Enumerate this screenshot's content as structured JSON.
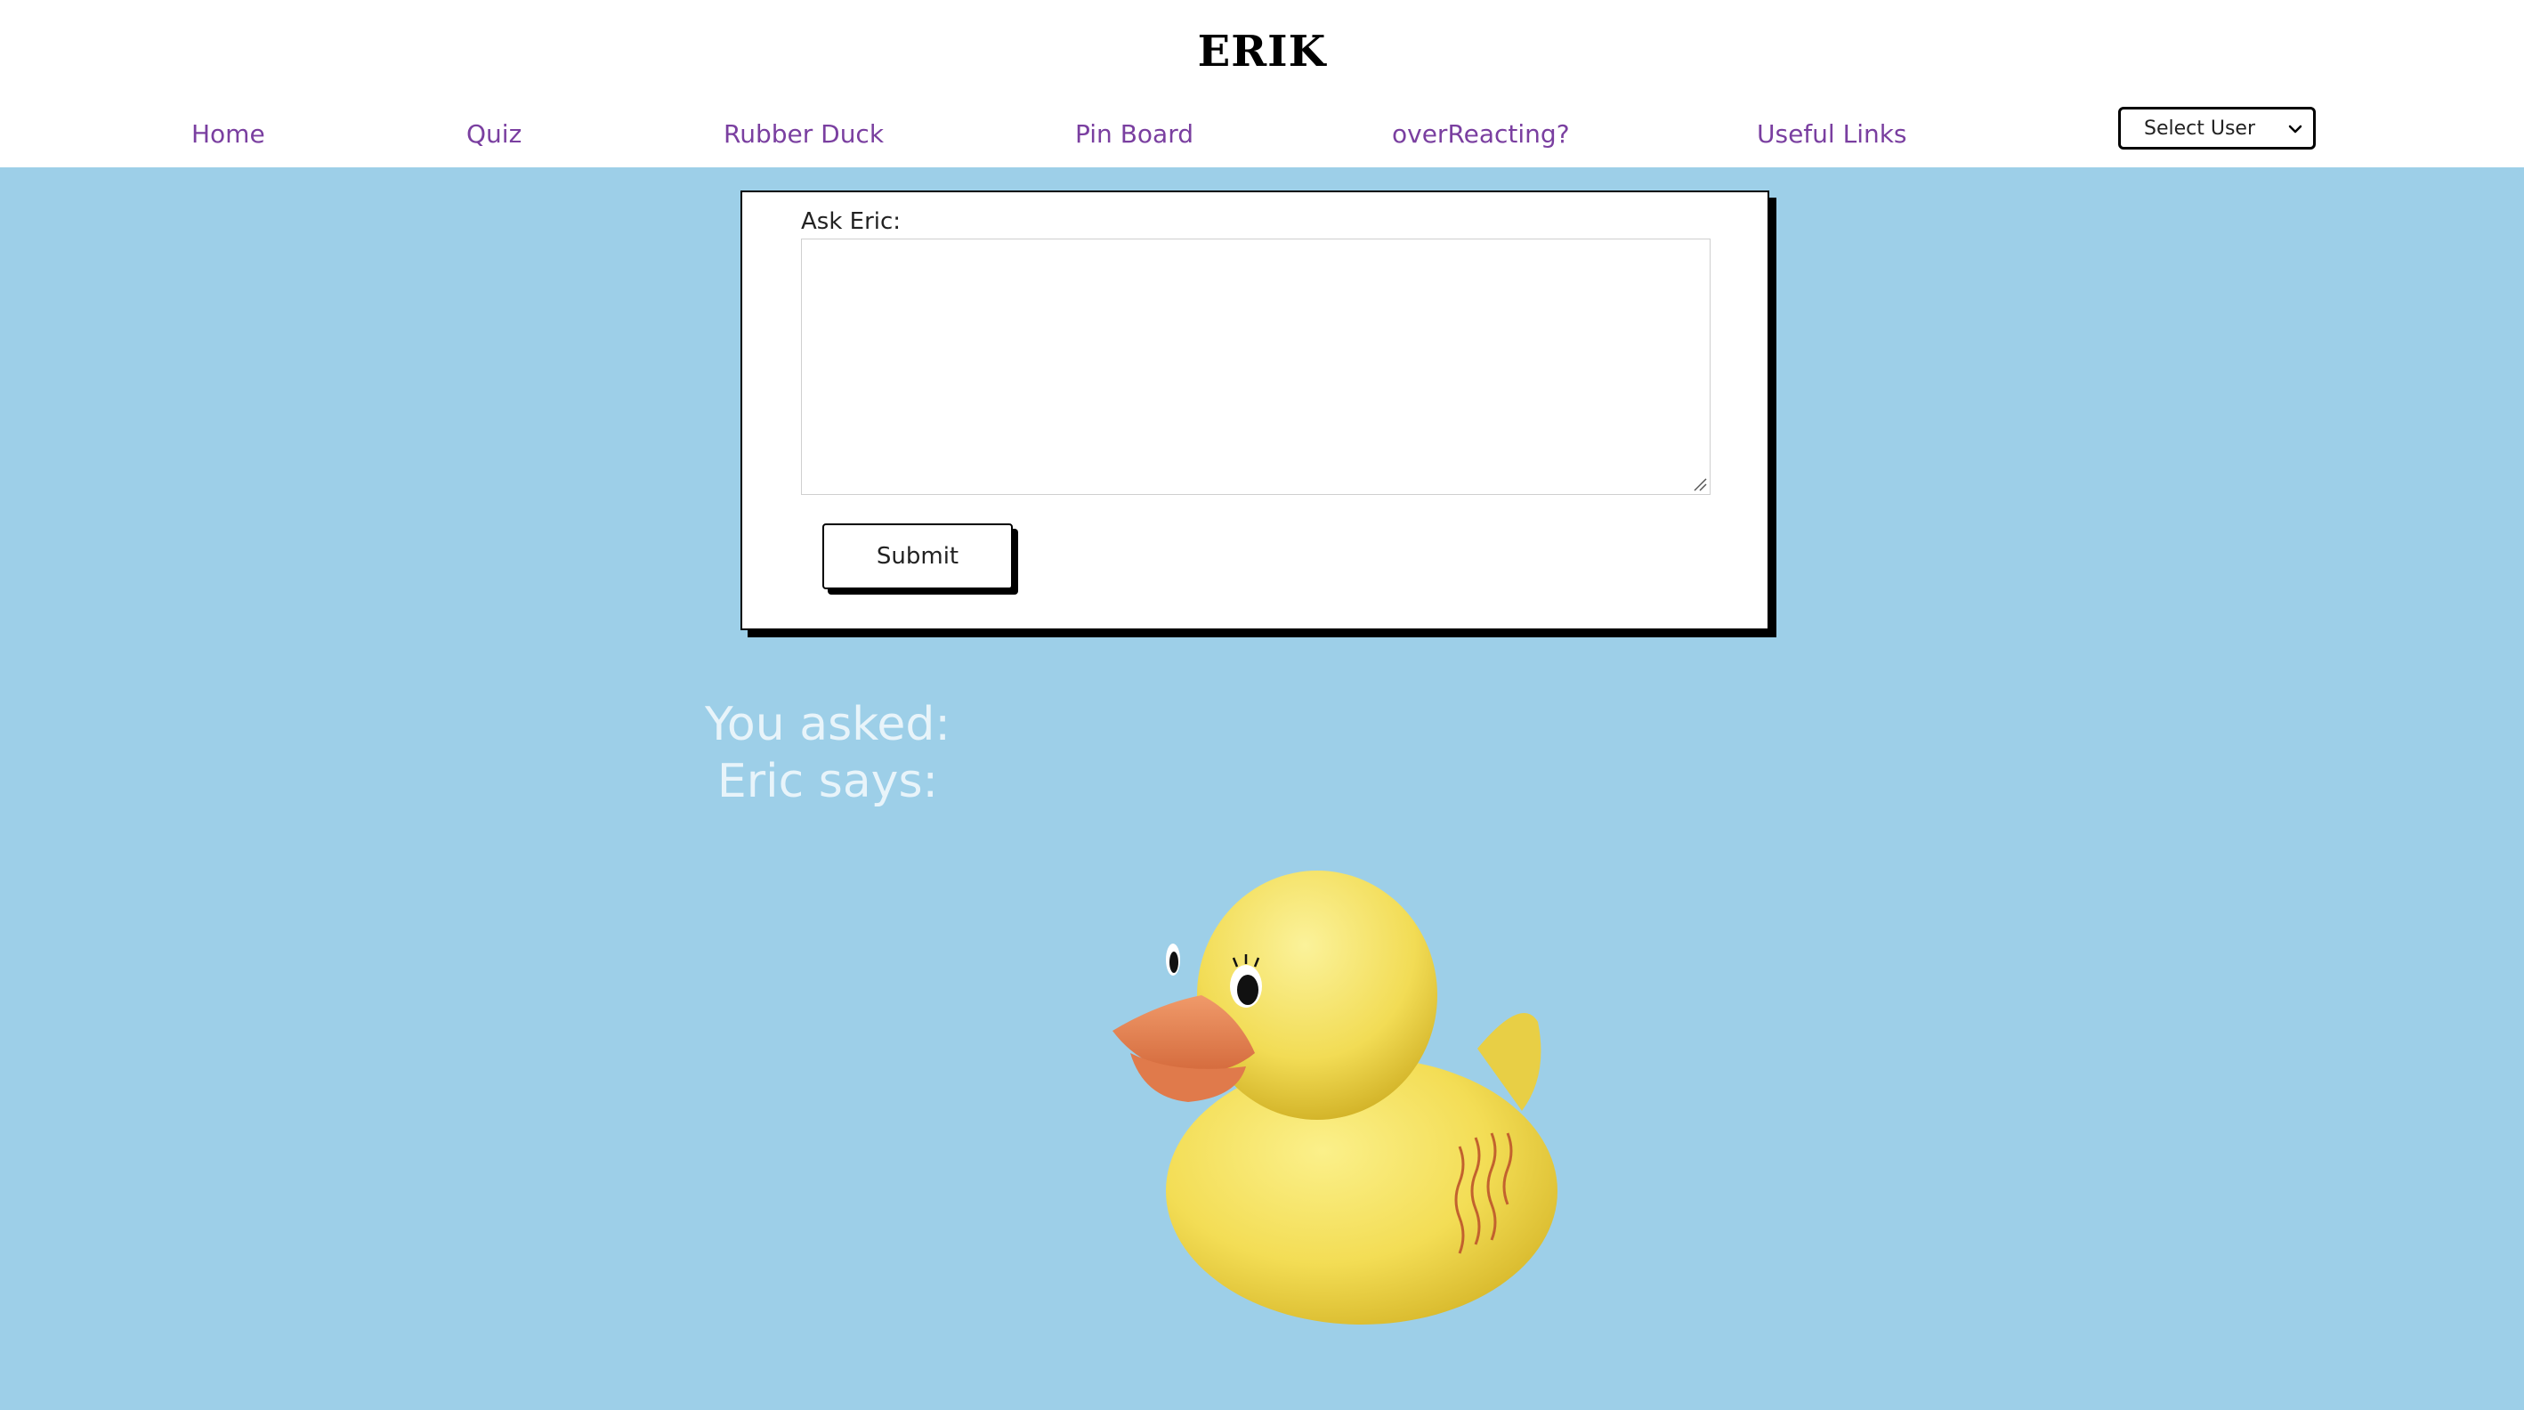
{
  "header": {
    "logo": "ERIK",
    "nav": [
      {
        "label": "Home"
      },
      {
        "label": "Quiz"
      },
      {
        "label": "Rubber Duck"
      },
      {
        "label": "Pin Board"
      },
      {
        "label": "overReacting?"
      },
      {
        "label": "Useful Links"
      }
    ],
    "user_select": {
      "selected": "Select User"
    }
  },
  "form": {
    "label": "Ask Eric:",
    "question_value": "",
    "submit_label": "Submit"
  },
  "result": {
    "asked_label": "You asked:",
    "says_label": "Eric says:"
  },
  "colors": {
    "background": "#9dcfe8",
    "nav_link": "#7a3fa0",
    "result_text": "#e8f4fa",
    "duck_body": "#f5e05a",
    "duck_beak": "#e8804f"
  },
  "icons": {
    "select": "chevron-down-icon",
    "duck": "rubber-duck-image"
  }
}
